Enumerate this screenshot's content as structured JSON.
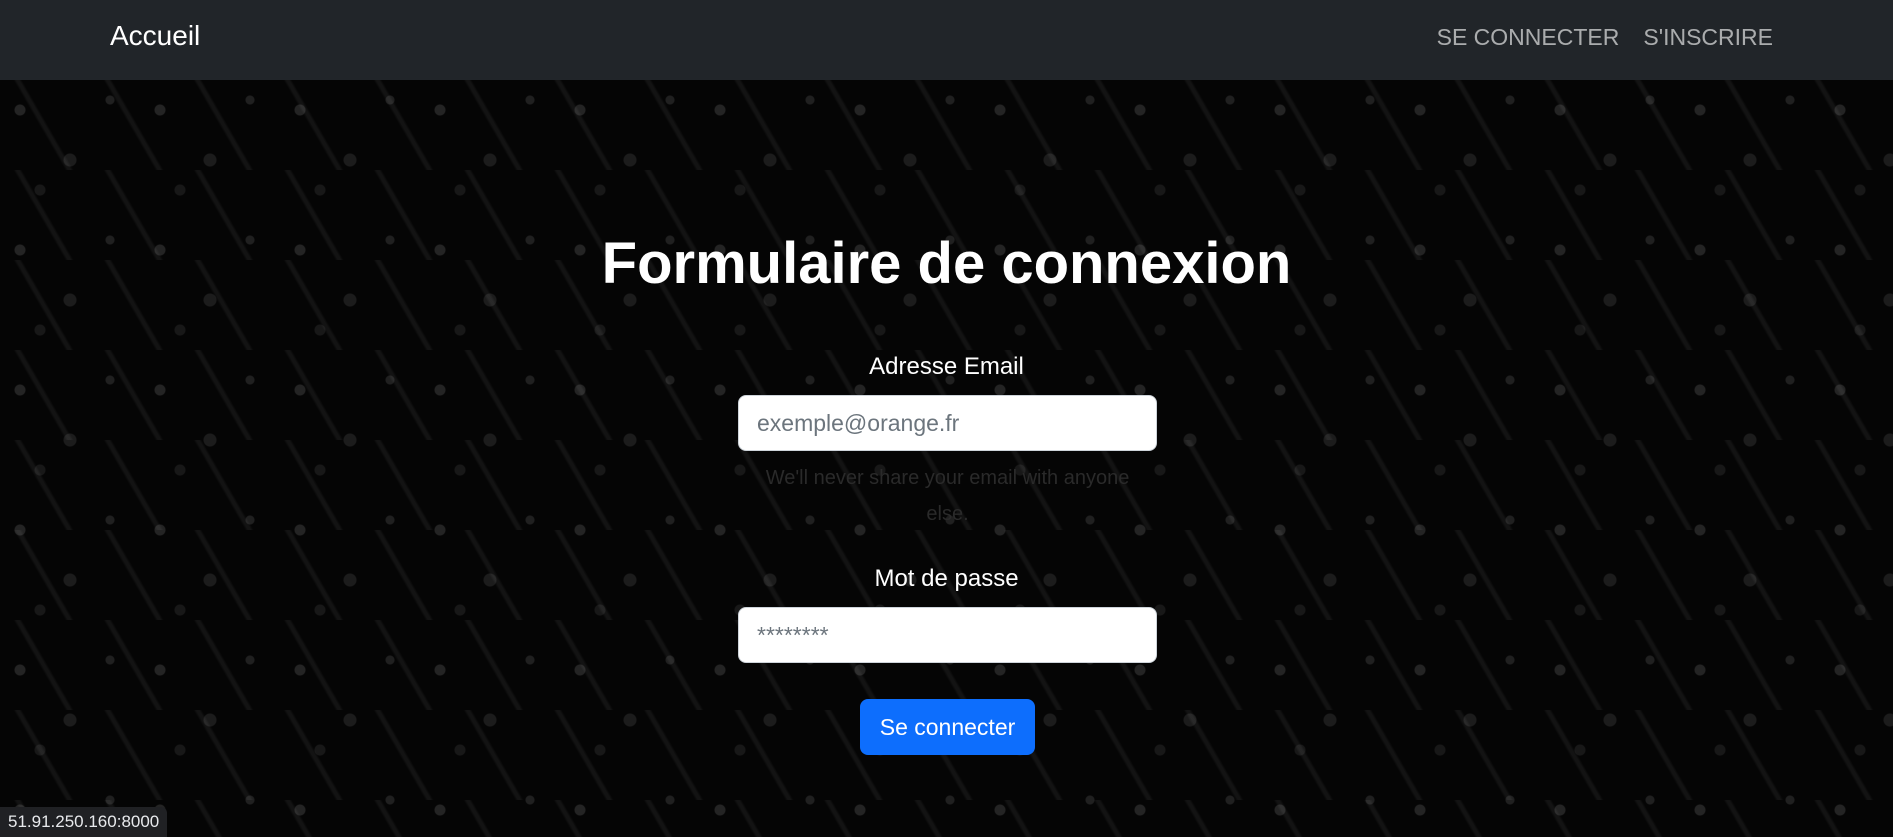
{
  "navbar": {
    "brand": "Accueil",
    "links": [
      {
        "label": "SE CONNECTER"
      },
      {
        "label": "S'INSCRIRE"
      }
    ]
  },
  "form": {
    "title": "Formulaire de connexion",
    "email": {
      "label": "Adresse Email",
      "placeholder": "exemple@orange.fr",
      "value": "",
      "help": "We'll never share your email with anyone else."
    },
    "password": {
      "label": "Mot de passe",
      "placeholder": "********",
      "value": ""
    },
    "submit_label": "Se connecter"
  },
  "status_bar": {
    "url": "51.91.250.160:8000"
  },
  "colors": {
    "navbar_bg": "#212529",
    "button_primary": "#0d6efd",
    "page_bg": "#000000"
  }
}
